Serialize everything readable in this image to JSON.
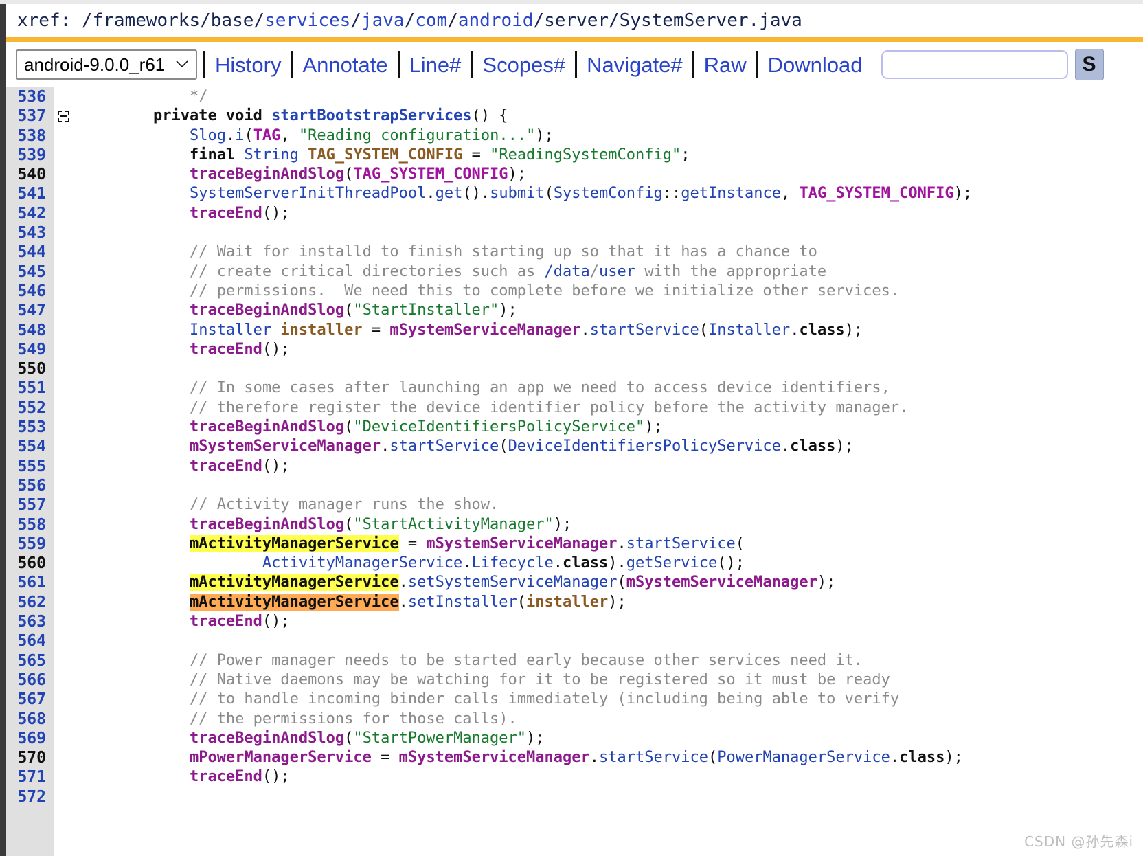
{
  "window": {
    "edge_color": "#3a3a3a",
    "accent_color": "#f7b733"
  },
  "header": {
    "prefix": "xref: ",
    "path_segments": [
      {
        "sep": "/",
        "text": "frameworks",
        "is_link": false
      },
      {
        "sep": "/",
        "text": "base",
        "is_link": false
      },
      {
        "sep": "/",
        "text": "services",
        "is_link": true
      },
      {
        "sep": "/",
        "text": "java",
        "is_link": true
      },
      {
        "sep": "/",
        "text": "com",
        "is_link": true
      },
      {
        "sep": "/",
        "text": "android",
        "is_link": true
      },
      {
        "sep": "/",
        "text": "server",
        "is_link": false
      },
      {
        "sep": "/",
        "text": "SystemServer.java",
        "is_link": false
      }
    ]
  },
  "toolbar": {
    "revision_selected": "android-9.0.0_r61",
    "revision_options": [
      "android-9.0.0_r61"
    ],
    "links": [
      "History",
      "Annotate",
      "Line#",
      "Scopes#",
      "Navigate#",
      "Raw",
      "Download"
    ],
    "search_value": "",
    "search_placeholder": "",
    "search_button_label": "S"
  },
  "code": {
    "first_line": 536,
    "lines": [
      {
        "n": 536,
        "fold": false,
        "tokens": [
          {
            "t": "            ",
            "c": "t-plain"
          },
          {
            "t": "*/",
            "c": "t-comment"
          }
        ]
      },
      {
        "n": 537,
        "fold": true,
        "tokens": [
          {
            "t": "        ",
            "c": "t-plain"
          },
          {
            "t": "private void ",
            "c": "t-kw"
          },
          {
            "t": "startBootstrapServices",
            "c": "t-func"
          },
          {
            "t": "() {",
            "c": "t-plain"
          }
        ]
      },
      {
        "n": 538,
        "fold": false,
        "tokens": [
          {
            "t": "            ",
            "c": "t-plain"
          },
          {
            "t": "Slog",
            "c": "t-type"
          },
          {
            "t": ".",
            "c": "t-plain"
          },
          {
            "t": "i",
            "c": "t-type"
          },
          {
            "t": "(",
            "c": "t-plain"
          },
          {
            "t": "TAG",
            "c": "t-constref"
          },
          {
            "t": ", ",
            "c": "t-plain"
          },
          {
            "t": "\"Reading configuration...\"",
            "c": "t-str"
          },
          {
            "t": ");",
            "c": "t-plain"
          }
        ]
      },
      {
        "n": 539,
        "fold": false,
        "tokens": [
          {
            "t": "            ",
            "c": "t-plain"
          },
          {
            "t": "final ",
            "c": "t-kw"
          },
          {
            "t": "String ",
            "c": "t-type"
          },
          {
            "t": "TAG_SYSTEM_CONFIG",
            "c": "t-const"
          },
          {
            "t": " = ",
            "c": "t-plain"
          },
          {
            "t": "\"ReadingSystemConfig\"",
            "c": "t-str"
          },
          {
            "t": ";",
            "c": "t-plain"
          }
        ]
      },
      {
        "n": 540,
        "fold": false,
        "tokens": [
          {
            "t": "            ",
            "c": "t-plain"
          },
          {
            "t": "traceBeginAndSlog",
            "c": "t-method"
          },
          {
            "t": "(",
            "c": "t-plain"
          },
          {
            "t": "TAG_SYSTEM_CONFIG",
            "c": "t-constref"
          },
          {
            "t": ");",
            "c": "t-plain"
          }
        ]
      },
      {
        "n": 541,
        "fold": false,
        "tokens": [
          {
            "t": "            ",
            "c": "t-plain"
          },
          {
            "t": "SystemServerInitThreadPool",
            "c": "t-ref"
          },
          {
            "t": ".",
            "c": "t-plain"
          },
          {
            "t": "get",
            "c": "t-ref"
          },
          {
            "t": "().",
            "c": "t-plain"
          },
          {
            "t": "submit",
            "c": "t-ref"
          },
          {
            "t": "(",
            "c": "t-plain"
          },
          {
            "t": "SystemConfig",
            "c": "t-ref"
          },
          {
            "t": "::",
            "c": "t-plain"
          },
          {
            "t": "getInstance",
            "c": "t-ref"
          },
          {
            "t": ", ",
            "c": "t-plain"
          },
          {
            "t": "TAG_SYSTEM_CONFIG",
            "c": "t-constref"
          },
          {
            "t": ");",
            "c": "t-plain"
          }
        ]
      },
      {
        "n": 542,
        "fold": false,
        "tokens": [
          {
            "t": "            ",
            "c": "t-plain"
          },
          {
            "t": "traceEnd",
            "c": "t-method"
          },
          {
            "t": "();",
            "c": "t-plain"
          }
        ]
      },
      {
        "n": 543,
        "fold": false,
        "tokens": []
      },
      {
        "n": 544,
        "fold": false,
        "tokens": [
          {
            "t": "            ",
            "c": "t-plain"
          },
          {
            "t": "// Wait for installd to finish starting up so that it has a chance to",
            "c": "t-comment"
          }
        ]
      },
      {
        "n": 545,
        "fold": false,
        "tokens": [
          {
            "t": "            ",
            "c": "t-plain"
          },
          {
            "t": "// create critical directories such as ",
            "c": "t-comment"
          },
          {
            "t": "/data",
            "c": "t-link"
          },
          {
            "t": "/",
            "c": "t-comment"
          },
          {
            "t": "user",
            "c": "t-link"
          },
          {
            "t": " with the appropriate",
            "c": "t-comment"
          }
        ]
      },
      {
        "n": 546,
        "fold": false,
        "tokens": [
          {
            "t": "            ",
            "c": "t-plain"
          },
          {
            "t": "// permissions.  We need this to complete before we initialize other services.",
            "c": "t-comment"
          }
        ]
      },
      {
        "n": 547,
        "fold": false,
        "tokens": [
          {
            "t": "            ",
            "c": "t-plain"
          },
          {
            "t": "traceBeginAndSlog",
            "c": "t-method"
          },
          {
            "t": "(",
            "c": "t-plain"
          },
          {
            "t": "\"StartInstaller\"",
            "c": "t-str"
          },
          {
            "t": ");",
            "c": "t-plain"
          }
        ]
      },
      {
        "n": 548,
        "fold": false,
        "tokens": [
          {
            "t": "            ",
            "c": "t-plain"
          },
          {
            "t": "Installer ",
            "c": "t-type"
          },
          {
            "t": "installer",
            "c": "t-local"
          },
          {
            "t": " = ",
            "c": "t-plain"
          },
          {
            "t": "mSystemServiceManager",
            "c": "t-var"
          },
          {
            "t": ".",
            "c": "t-plain"
          },
          {
            "t": "startService",
            "c": "t-ref"
          },
          {
            "t": "(",
            "c": "t-plain"
          },
          {
            "t": "Installer",
            "c": "t-ref"
          },
          {
            "t": ".",
            "c": "t-plain"
          },
          {
            "t": "class",
            "c": "t-classkw"
          },
          {
            "t": ");",
            "c": "t-plain"
          }
        ]
      },
      {
        "n": 549,
        "fold": false,
        "tokens": [
          {
            "t": "            ",
            "c": "t-plain"
          },
          {
            "t": "traceEnd",
            "c": "t-method"
          },
          {
            "t": "();",
            "c": "t-plain"
          }
        ]
      },
      {
        "n": 550,
        "fold": false,
        "tokens": []
      },
      {
        "n": 551,
        "fold": false,
        "tokens": [
          {
            "t": "            ",
            "c": "t-plain"
          },
          {
            "t": "// In some cases after launching an app we need to access device identifiers,",
            "c": "t-comment"
          }
        ]
      },
      {
        "n": 552,
        "fold": false,
        "tokens": [
          {
            "t": "            ",
            "c": "t-plain"
          },
          {
            "t": "// therefore register the device identifier policy before the activity manager.",
            "c": "t-comment"
          }
        ]
      },
      {
        "n": 553,
        "fold": false,
        "tokens": [
          {
            "t": "            ",
            "c": "t-plain"
          },
          {
            "t": "traceBeginAndSlog",
            "c": "t-method"
          },
          {
            "t": "(",
            "c": "t-plain"
          },
          {
            "t": "\"DeviceIdentifiersPolicyService\"",
            "c": "t-str"
          },
          {
            "t": ");",
            "c": "t-plain"
          }
        ]
      },
      {
        "n": 554,
        "fold": false,
        "tokens": [
          {
            "t": "            ",
            "c": "t-plain"
          },
          {
            "t": "mSystemServiceManager",
            "c": "t-var"
          },
          {
            "t": ".",
            "c": "t-plain"
          },
          {
            "t": "startService",
            "c": "t-ref"
          },
          {
            "t": "(",
            "c": "t-plain"
          },
          {
            "t": "DeviceIdentifiersPolicyService",
            "c": "t-ref"
          },
          {
            "t": ".",
            "c": "t-plain"
          },
          {
            "t": "class",
            "c": "t-classkw"
          },
          {
            "t": ");",
            "c": "t-plain"
          }
        ]
      },
      {
        "n": 555,
        "fold": false,
        "tokens": [
          {
            "t": "            ",
            "c": "t-plain"
          },
          {
            "t": "traceEnd",
            "c": "t-method"
          },
          {
            "t": "();",
            "c": "t-plain"
          }
        ]
      },
      {
        "n": 556,
        "fold": false,
        "tokens": []
      },
      {
        "n": 557,
        "fold": false,
        "tokens": [
          {
            "t": "            ",
            "c": "t-plain"
          },
          {
            "t": "// Activity manager runs the show.",
            "c": "t-comment"
          }
        ]
      },
      {
        "n": 558,
        "fold": false,
        "tokens": [
          {
            "t": "            ",
            "c": "t-plain"
          },
          {
            "t": "traceBeginAndSlog",
            "c": "t-method"
          },
          {
            "t": "(",
            "c": "t-plain"
          },
          {
            "t": "\"StartActivityManager\"",
            "c": "t-str"
          },
          {
            "t": ");",
            "c": "t-plain"
          }
        ]
      },
      {
        "n": 559,
        "fold": false,
        "tokens": [
          {
            "t": "            ",
            "c": "t-plain"
          },
          {
            "t": "mActivityManagerService",
            "c": "hl-yellow"
          },
          {
            "t": " = ",
            "c": "t-plain"
          },
          {
            "t": "mSystemServiceManager",
            "c": "t-var"
          },
          {
            "t": ".",
            "c": "t-plain"
          },
          {
            "t": "startService",
            "c": "t-ref"
          },
          {
            "t": "(",
            "c": "t-plain"
          }
        ]
      },
      {
        "n": 560,
        "fold": false,
        "tokens": [
          {
            "t": "                    ",
            "c": "t-plain"
          },
          {
            "t": "ActivityManagerService",
            "c": "t-ref"
          },
          {
            "t": ".",
            "c": "t-plain"
          },
          {
            "t": "Lifecycle",
            "c": "t-ref"
          },
          {
            "t": ".",
            "c": "t-plain"
          },
          {
            "t": "class",
            "c": "t-classkw"
          },
          {
            "t": ").",
            "c": "t-plain"
          },
          {
            "t": "getService",
            "c": "t-ref"
          },
          {
            "t": "();",
            "c": "t-plain"
          }
        ]
      },
      {
        "n": 561,
        "fold": false,
        "tokens": [
          {
            "t": "            ",
            "c": "t-plain"
          },
          {
            "t": "mActivityManagerService",
            "c": "hl-yellow"
          },
          {
            "t": ".",
            "c": "t-plain"
          },
          {
            "t": "setSystemServiceManager",
            "c": "t-ref"
          },
          {
            "t": "(",
            "c": "t-plain"
          },
          {
            "t": "mSystemServiceManager",
            "c": "t-var"
          },
          {
            "t": ");",
            "c": "t-plain"
          }
        ]
      },
      {
        "n": 562,
        "fold": false,
        "tokens": [
          {
            "t": "            ",
            "c": "t-plain"
          },
          {
            "t": "mActivityManagerService",
            "c": "hl-orange"
          },
          {
            "t": ".",
            "c": "t-plain"
          },
          {
            "t": "setInstaller",
            "c": "t-ref"
          },
          {
            "t": "(",
            "c": "t-plain"
          },
          {
            "t": "installer",
            "c": "t-local"
          },
          {
            "t": ");",
            "c": "t-plain"
          }
        ]
      },
      {
        "n": 563,
        "fold": false,
        "tokens": [
          {
            "t": "            ",
            "c": "t-plain"
          },
          {
            "t": "traceEnd",
            "c": "t-method"
          },
          {
            "t": "();",
            "c": "t-plain"
          }
        ]
      },
      {
        "n": 564,
        "fold": false,
        "tokens": []
      },
      {
        "n": 565,
        "fold": false,
        "tokens": [
          {
            "t": "            ",
            "c": "t-plain"
          },
          {
            "t": "// Power manager needs to be started early because other services need it.",
            "c": "t-comment"
          }
        ]
      },
      {
        "n": 566,
        "fold": false,
        "tokens": [
          {
            "t": "            ",
            "c": "t-plain"
          },
          {
            "t": "// Native daemons may be watching for it to be registered so it must be ready",
            "c": "t-comment"
          }
        ]
      },
      {
        "n": 567,
        "fold": false,
        "tokens": [
          {
            "t": "            ",
            "c": "t-plain"
          },
          {
            "t": "// to handle incoming binder calls immediately (including being able to verify",
            "c": "t-comment"
          }
        ]
      },
      {
        "n": 568,
        "fold": false,
        "tokens": [
          {
            "t": "            ",
            "c": "t-plain"
          },
          {
            "t": "// the permissions for those calls).",
            "c": "t-comment"
          }
        ]
      },
      {
        "n": 569,
        "fold": false,
        "tokens": [
          {
            "t": "            ",
            "c": "t-plain"
          },
          {
            "t": "traceBeginAndSlog",
            "c": "t-method"
          },
          {
            "t": "(",
            "c": "t-plain"
          },
          {
            "t": "\"StartPowerManager\"",
            "c": "t-str"
          },
          {
            "t": ");",
            "c": "t-plain"
          }
        ]
      },
      {
        "n": 570,
        "fold": false,
        "tokens": [
          {
            "t": "            ",
            "c": "t-plain"
          },
          {
            "t": "mPowerManagerService",
            "c": "t-var"
          },
          {
            "t": " = ",
            "c": "t-plain"
          },
          {
            "t": "mSystemServiceManager",
            "c": "t-var"
          },
          {
            "t": ".",
            "c": "t-plain"
          },
          {
            "t": "startService",
            "c": "t-ref"
          },
          {
            "t": "(",
            "c": "t-plain"
          },
          {
            "t": "PowerManagerService",
            "c": "t-ref"
          },
          {
            "t": ".",
            "c": "t-plain"
          },
          {
            "t": "class",
            "c": "t-classkw"
          },
          {
            "t": ");",
            "c": "t-plain"
          }
        ]
      },
      {
        "n": 571,
        "fold": false,
        "tokens": [
          {
            "t": "            ",
            "c": "t-plain"
          },
          {
            "t": "traceEnd",
            "c": "t-method"
          },
          {
            "t": "();",
            "c": "t-plain"
          }
        ]
      },
      {
        "n": 572,
        "fold": false,
        "tokens": []
      }
    ]
  },
  "watermark": {
    "text": "CSDN @孙先森i"
  }
}
